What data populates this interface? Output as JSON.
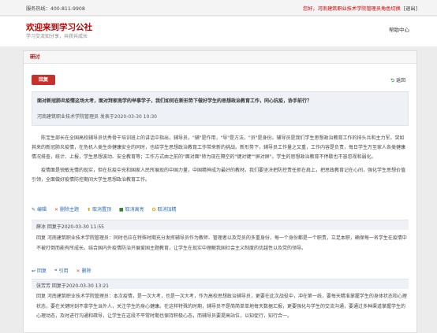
{
  "topbar": {
    "hotline": "服务热线：400-811-9908",
    "greeting": "您好，河南建筑职业技术学院管理员角色切换",
    "logout": "[退出]"
  },
  "header": {
    "title": "欢迎来到学习公社",
    "subtitle": "学习交流知分享，共获共成长",
    "help": "帮助中心"
  },
  "panel": {
    "heading": "研讨"
  },
  "toolbar": {
    "reply": "回复",
    "back": "返回"
  },
  "topic": {
    "title": "面对新冠肺炎疫情这场大考，面对拜家南学的举事学子，我们如何在新形势下做好学生的思想政治教育工作，同心抗疫，协手前行？",
    "meta": "河南建筑职业技术学院管理员 发表于2020-03-30 10:30",
    "paragraphs": [
      "陈宝生部长在全国高校辅导员优秀骨干培训班上的讲话中指出，辅导员，\"辅\"是作用，\"导\"是方法，\"员\"是身份。辅导员是我们学生思想政治教育工作的排头兵和主力军。突如其来的新冠肺炎疫情，在危机人类生命健康安全的同时，也给学生思想政治教育工作带来新的挑战。新形势下，辅导员工作量之又重，工作内容是负责，每日学生万至家人各类健康情况排查，统计、上报，学生思想波动、安全教育等；工作方式由之前的\"面对面\"转为现在隔空的\"键对键\"\"屏对屏\"。学生的思想政治教育不停歇也不容忽视和弱化。",
      "疫情面是锐敏无情的现实，但在抗疫中充和国家人民所展现的中国力量，中国精神成为最好的教材。我们要坚决把防控责任抓在肩上，把思政教育记在心间，强化学生思想价值引领，全面做好疫情防控期间大学生思想政治教育工作。"
    ],
    "actions": [
      "编辑",
      "删除主题",
      "取消置顶",
      "取消高亮",
      "取消加精"
    ]
  },
  "replies": [
    {
      "author": "薛冰",
      "meta": "薛冰  回复于2020-03-30 11:55",
      "text": "回复 河南建筑职业技术学院管理员：同时也应在特殊时期充分发挥辅导员作为教师、管理者以及党员的多重身份，每一个身份都是一个职责，立足本职，确保每一名学生在疫情中不被打倒而能有所成长。结合国内外疫情防治开展爱国主题教育，让学生在现实中理解我国社会主义制度的优越性以及党的领导。",
      "actions": [
        "回复",
        "引用",
        "删除"
      ]
    },
    {
      "author": "张芳芳",
      "meta": "张芳芳  回复于2020-03-30 13:21",
      "text": "回复 河南建筑职业技术学院管理员：本次疫情，是一次大考，也是一次大考，作为高校思想政治辅导员，更要在此次战役中，冲在第一线，要每天精准掌握学生的身体状态和心理状态，要在关键时刻不拿学生当外人，关注学生的身心健康。在这样特殊的时期，辅导员不是简简单单地每天数据汇报，更要强化与学生的交流沟通，要通过多种渠道掌握学生的心理动态，及时进行沟通和疏导，让学生在这段不平常时期也保持积极心态，而辅导员要提高站位，以知促行，知行合一。"
    }
  ]
}
